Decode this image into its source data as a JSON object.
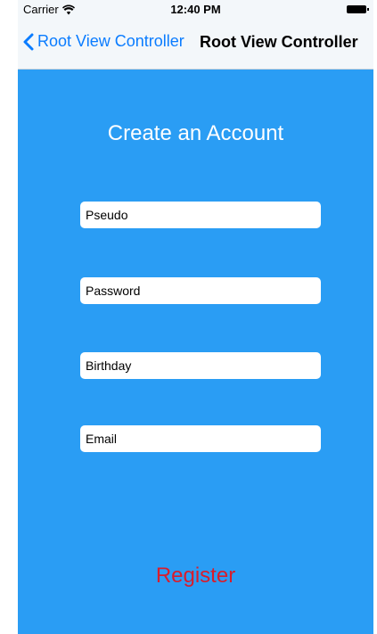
{
  "status_bar": {
    "carrier": "Carrier",
    "time": "12:40 PM",
    "wifi_icon": "wifi-icon",
    "battery_icon": "battery-icon"
  },
  "nav": {
    "back_label": "Root View Controller",
    "title": "Root View Controller",
    "back_icon": "chevron-left-icon"
  },
  "form": {
    "heading": "Create an Account",
    "fields": {
      "pseudo": {
        "placeholder": "Pseudo"
      },
      "password": {
        "placeholder": "Password"
      },
      "birthday": {
        "placeholder": "Birthday"
      },
      "email": {
        "placeholder": "Email"
      }
    },
    "register_label": "Register"
  },
  "colors": {
    "background": "#2a9df4",
    "nav_background": "#f3f7fa",
    "tint": "#0a7cff",
    "register": "#d81d2c"
  }
}
